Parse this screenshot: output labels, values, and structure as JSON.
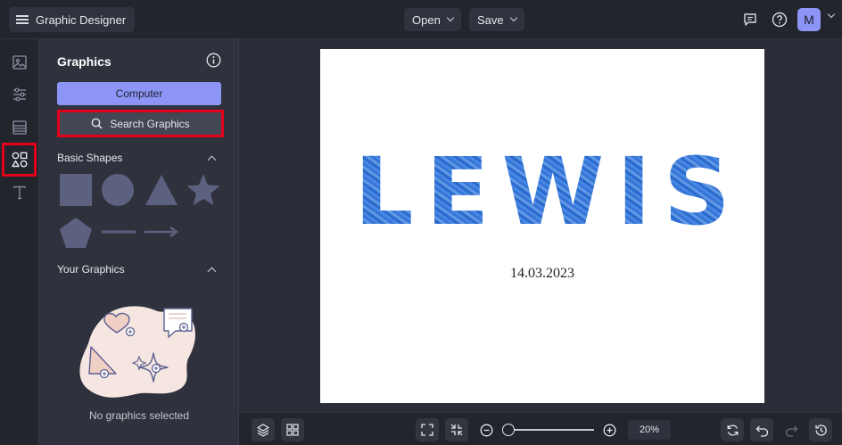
{
  "topbar": {
    "app_title": "Graphic Designer",
    "open_label": "Open",
    "save_label": "Save",
    "avatar_initial": "M"
  },
  "rail": {
    "items": [
      {
        "icon": "image-icon"
      },
      {
        "icon": "sliders-icon"
      },
      {
        "icon": "layout-icon"
      },
      {
        "icon": "graphics-icon",
        "active": true
      },
      {
        "icon": "text-icon"
      }
    ]
  },
  "panel": {
    "title": "Graphics",
    "computer_button": "Computer",
    "search_button": "Search Graphics",
    "basic_shapes_label": "Basic Shapes",
    "your_graphics_label": "Your Graphics",
    "empty_message": "No graphics selected"
  },
  "canvas": {
    "headline": "LEWIS",
    "date": "14.03.2023"
  },
  "bottombar": {
    "zoom_value": "20%"
  },
  "colors": {
    "accent": "#8c95f5",
    "highlight": "#e3001b",
    "shape_fill": "#5d6180"
  }
}
